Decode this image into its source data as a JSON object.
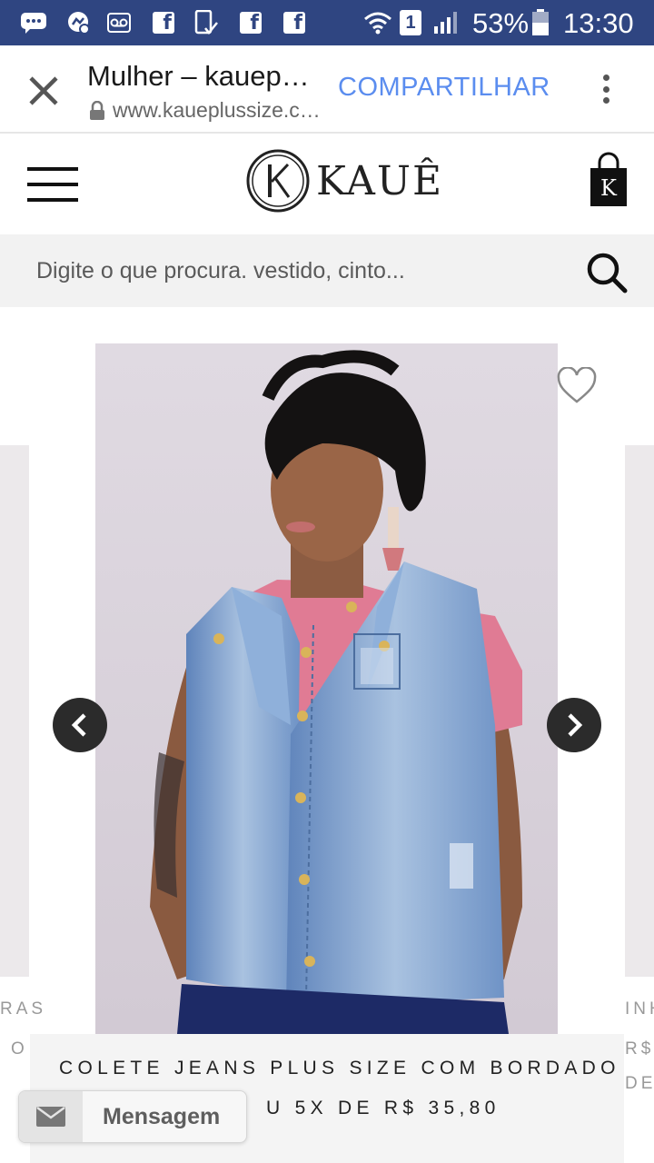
{
  "status_bar": {
    "battery": "53%",
    "time": "13:30",
    "sim_badge": "1",
    "icons": [
      "chat-icon",
      "messenger-icon",
      "voicemail-icon",
      "facebook-icon",
      "phone-check-icon",
      "facebook-icon",
      "facebook-icon",
      "wifi-icon",
      "sim-icon",
      "signal-icon",
      "battery-icon"
    ]
  },
  "browser": {
    "title": "Mulher – kauep…",
    "url": "www.kaueplussize.c…",
    "share_label": "COMPARTILHAR"
  },
  "site": {
    "logo_text": "KAUÊ",
    "cart_letter": "K"
  },
  "search": {
    "placeholder": "Digite o que procura. vestido, cinto..."
  },
  "carousel": {
    "left_peek": [
      "RAS",
      "O"
    ],
    "right_peek": [
      "INH",
      "R$",
      "DE"
    ],
    "product": {
      "name": "COLETE JEANS PLUS SIZE COM BORDADO",
      "price_line": "U 5X DE R$ 35,80"
    }
  },
  "chat": {
    "label": "Mensagem"
  },
  "colors": {
    "status_bar": "#2f4581",
    "link_blue": "#5b8def",
    "denim": "#7a9cc9",
    "top_pink": "#e07b94"
  }
}
